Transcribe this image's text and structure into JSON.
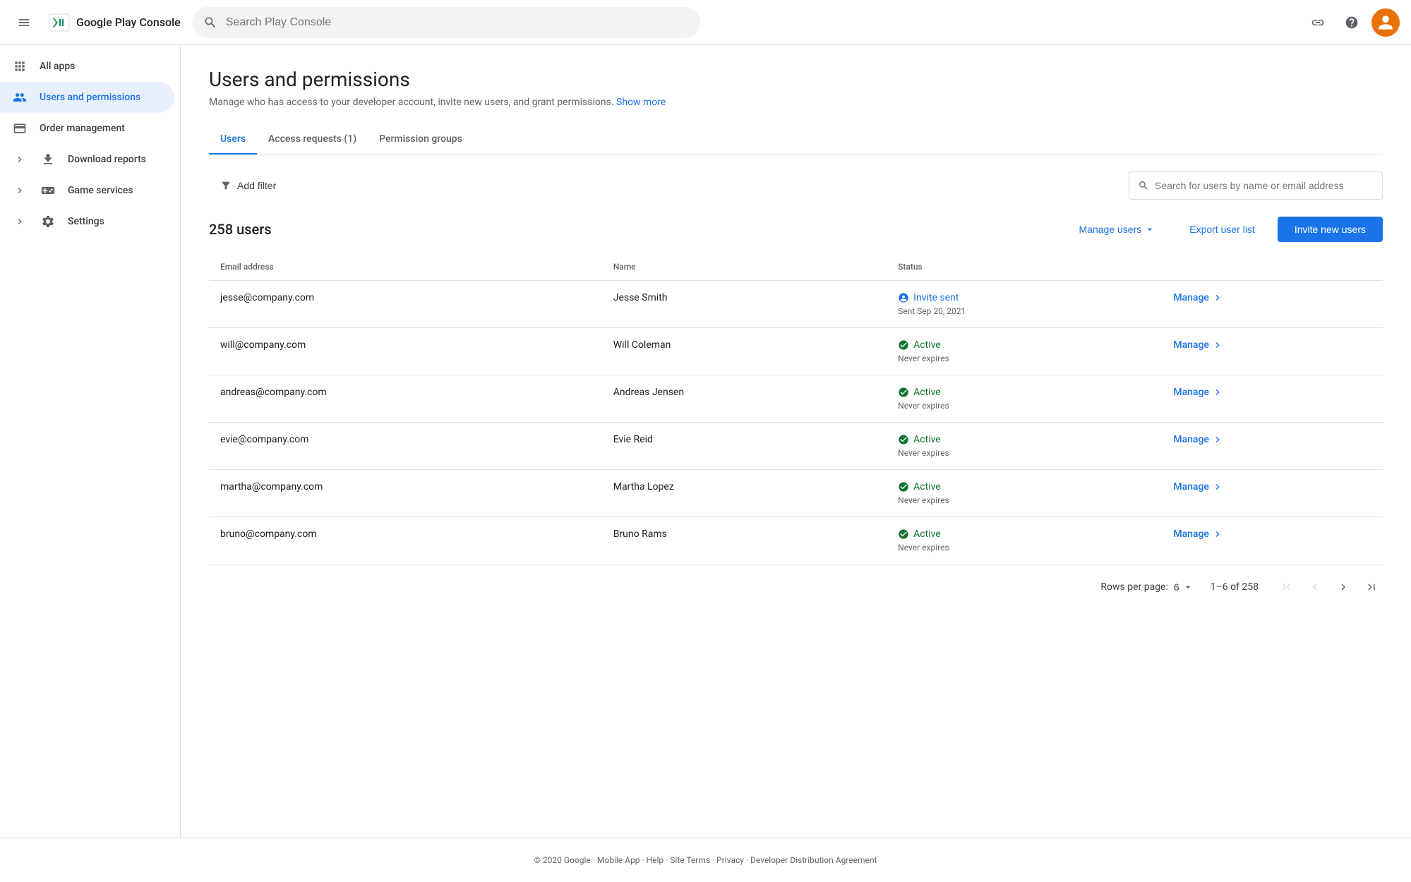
{
  "topbar": {
    "logo_text": "Google Play Console",
    "search_placeholder": "Search Play Console"
  },
  "sidebar": {
    "items": [
      {
        "id": "all-apps",
        "label": "All apps",
        "icon": "grid",
        "active": false,
        "expandable": false
      },
      {
        "id": "users-permissions",
        "label": "Users and permissions",
        "icon": "users",
        "active": true,
        "expandable": false
      },
      {
        "id": "order-management",
        "label": "Order management",
        "icon": "credit-card",
        "active": false,
        "expandable": false
      },
      {
        "id": "download-reports",
        "label": "Download reports",
        "icon": "download",
        "active": false,
        "expandable": true
      },
      {
        "id": "game-services",
        "label": "Game services",
        "icon": "game",
        "active": false,
        "expandable": true
      },
      {
        "id": "settings",
        "label": "Settings",
        "icon": "settings",
        "active": false,
        "expandable": true
      }
    ]
  },
  "page": {
    "title": "Users and permissions",
    "subtitle": "Manage who has access to your developer account, invite new users, and grant permissions.",
    "show_more": "Show more"
  },
  "tabs": [
    {
      "id": "users",
      "label": "Users",
      "active": true
    },
    {
      "id": "access-requests",
      "label": "Access requests (1)",
      "active": false
    },
    {
      "id": "permission-groups",
      "label": "Permission groups",
      "active": false
    }
  ],
  "filter": {
    "add_filter_label": "Add filter"
  },
  "search": {
    "placeholder": "Search for users by name or email address"
  },
  "users_section": {
    "count_label": "258 users",
    "manage_label": "Manage users",
    "export_label": "Export user list",
    "invite_label": "Invite new users"
  },
  "table": {
    "columns": [
      "Email address",
      "Name",
      "Status"
    ],
    "rows": [
      {
        "email": "jesse@company.com",
        "name": "Jesse Smith",
        "status_type": "invite",
        "status_label": "Invite sent",
        "status_sub": "Sent Sep 20, 2021",
        "manage_label": "Manage"
      },
      {
        "email": "will@company.com",
        "name": "Will Coleman",
        "status_type": "active",
        "status_label": "Active",
        "status_sub": "Never expires",
        "manage_label": "Manage"
      },
      {
        "email": "andreas@company.com",
        "name": "Andreas Jensen",
        "status_type": "active",
        "status_label": "Active",
        "status_sub": "Never expires",
        "manage_label": "Manage"
      },
      {
        "email": "evie@company.com",
        "name": "Evie Reid",
        "status_type": "active",
        "status_label": "Active",
        "status_sub": "Never expires",
        "manage_label": "Manage"
      },
      {
        "email": "martha@company.com",
        "name": "Martha Lopez",
        "status_type": "active",
        "status_label": "Active",
        "status_sub": "Never expires",
        "manage_label": "Manage"
      },
      {
        "email": "bruno@company.com",
        "name": "Bruno Rams",
        "status_type": "active",
        "status_label": "Active",
        "status_sub": "Never expires",
        "manage_label": "Manage"
      }
    ]
  },
  "pagination": {
    "rows_per_page_label": "Rows per page:",
    "rows_per_page_value": "6",
    "range_label": "1–6 of 258"
  },
  "footer": {
    "copyright": "© 2020 Google",
    "links": [
      "Mobile App",
      "Help",
      "Site Terms",
      "Privacy",
      "Developer Distribution Agreement"
    ]
  }
}
